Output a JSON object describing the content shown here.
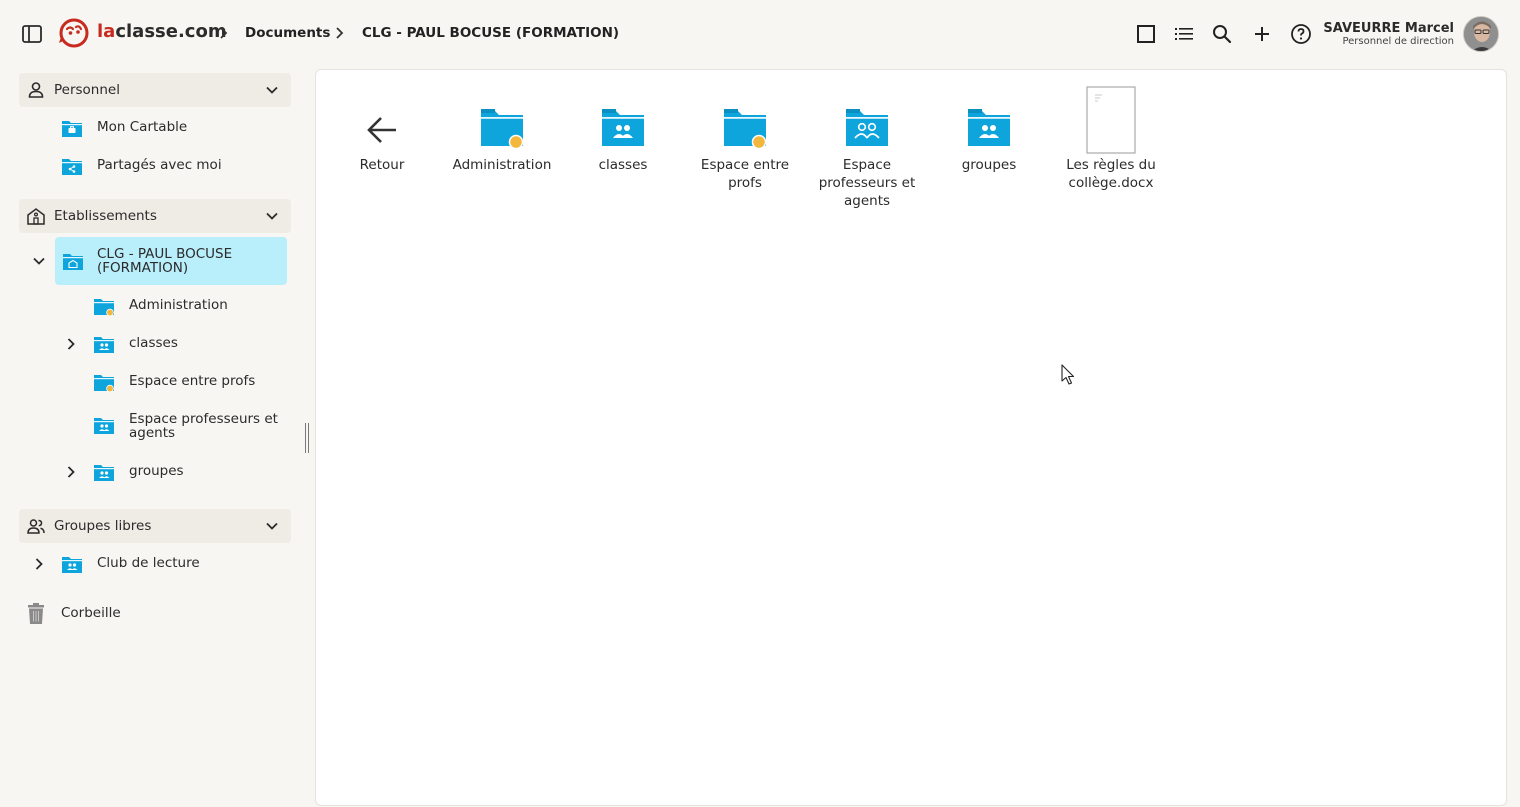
{
  "header": {
    "brand_prefix": "la",
    "brand_rest": "classe.com",
    "breadcrumbs": [
      "Documents",
      "CLG - PAUL BOCUSE (FORMATION)"
    ],
    "user": {
      "name": "SAVEURRE Marcel",
      "role": "Personnel de direction"
    },
    "icons": [
      "sidebar-toggle-icon",
      "grid-view-icon",
      "list-view-icon",
      "search-icon",
      "add-icon",
      "help-icon"
    ]
  },
  "sidebar": {
    "personnel": {
      "label": "Personnel",
      "items": [
        {
          "label": "Mon Cartable",
          "icon": "briefcase-folder-icon"
        },
        {
          "label": "Partagés avec moi",
          "icon": "shared-folder-icon"
        }
      ]
    },
    "etablissements": {
      "label": "Etablissements",
      "school": {
        "label": "CLG - PAUL BOCUSE (FORMATION)"
      },
      "items": [
        {
          "label": "Administration",
          "icon": "folder-dot-icon"
        },
        {
          "label": "classes",
          "icon": "group-folder-icon"
        },
        {
          "label": "Espace entre profs",
          "icon": "folder-dot-icon"
        },
        {
          "label": "Espace professeurs et agents",
          "icon": "group-folder-icon"
        },
        {
          "label": "groupes",
          "icon": "group-folder-icon"
        }
      ]
    },
    "groupes_libres": {
      "label": "Groupes libres",
      "items": [
        {
          "label": "Club de lecture",
          "icon": "group-folder-icon"
        }
      ]
    },
    "trash": {
      "label": "Corbeille"
    }
  },
  "main": {
    "tiles": [
      {
        "label": "Retour",
        "icon": "back-arrow-icon"
      },
      {
        "label": "Administration",
        "icon": "folder-dot-icon"
      },
      {
        "label": "classes",
        "icon": "group-folder-icon"
      },
      {
        "label": "Espace entre profs",
        "icon": "folder-dot-icon"
      },
      {
        "label": "Espace professeurs et agents",
        "icon": "group-folder-icon"
      },
      {
        "label": "groupes",
        "icon": "group-folder-icon"
      },
      {
        "label": "Les règles du collège.docx",
        "icon": "document-icon"
      }
    ]
  },
  "colors": {
    "folder": "#0ea5dd",
    "folder_tab": "#0b8ec2",
    "dot": "#f4b73d",
    "selected_bg": "#b9eefb",
    "brand": "#c72a1e"
  }
}
